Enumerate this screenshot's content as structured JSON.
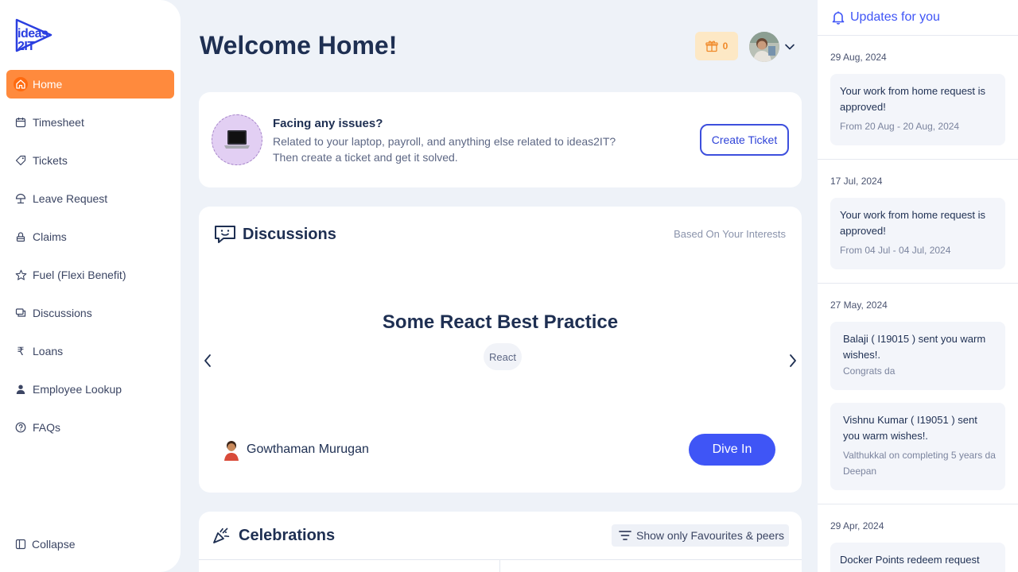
{
  "logo": {
    "text": "ideas2IT"
  },
  "sidebar": {
    "items": [
      {
        "label": "Home",
        "icon": "home-icon",
        "active": true
      },
      {
        "label": "Timesheet",
        "icon": "calendar-icon"
      },
      {
        "label": "Tickets",
        "icon": "ticket-icon"
      },
      {
        "label": "Leave Request",
        "icon": "umbrella-icon"
      },
      {
        "label": "Claims",
        "icon": "claims-icon"
      },
      {
        "label": "Fuel (Flexi Benefit)",
        "icon": "star-icon"
      },
      {
        "label": "Discussions",
        "icon": "discussions-icon"
      },
      {
        "label": "Loans",
        "icon": "rupee-icon"
      },
      {
        "label": "Employee Lookup",
        "icon": "person-icon"
      },
      {
        "label": "FAQs",
        "icon": "question-icon"
      }
    ],
    "collapse_label": "Collapse"
  },
  "header": {
    "title": "Welcome Home!",
    "gift_count": "0"
  },
  "issue_card": {
    "title": "Facing any issues?",
    "line1": "Related to your laptop, payroll, and anything else related to ideas2IT?",
    "line2": "Then create a ticket and get it solved.",
    "button": "Create Ticket"
  },
  "discussions": {
    "title": "Discussions",
    "subtitle": "Based On Your Interests",
    "post_title": "Some React Best Practice",
    "tag": "React",
    "author": "Gowthaman Murugan",
    "button": "Dive In"
  },
  "celebrations": {
    "title": "Celebrations",
    "filter_label": "Show only Favourites & peers"
  },
  "updates": {
    "title": "Updates for you",
    "groups": [
      {
        "date": "29 Aug, 2024",
        "items": [
          {
            "text": "Your work from home request is approved!",
            "sub": "From 20 Aug - 20 Aug, 2024"
          }
        ]
      },
      {
        "date": "17 Jul, 2024",
        "items": [
          {
            "text": "Your work from home request is approved!",
            "sub": "From 04 Jul - 04 Jul, 2024"
          }
        ]
      },
      {
        "date": "27 May, 2024",
        "items": [
          {
            "text": "Balaji ( I19015 ) sent you warm wishes!.",
            "sub": "Congrats da"
          },
          {
            "text": "Vishnu Kumar ( I19051 ) sent you warm wishes!.",
            "sub": "Valthukkal on completing 5 years da Deepan"
          }
        ]
      },
      {
        "date": "29 Apr, 2024",
        "items": [
          {
            "text": "Docker Points redeem request",
            "sub": ""
          }
        ]
      }
    ]
  },
  "colors": {
    "accent": "#ff8a3d",
    "primary": "#3f55f6",
    "heading": "#1e2f52"
  }
}
